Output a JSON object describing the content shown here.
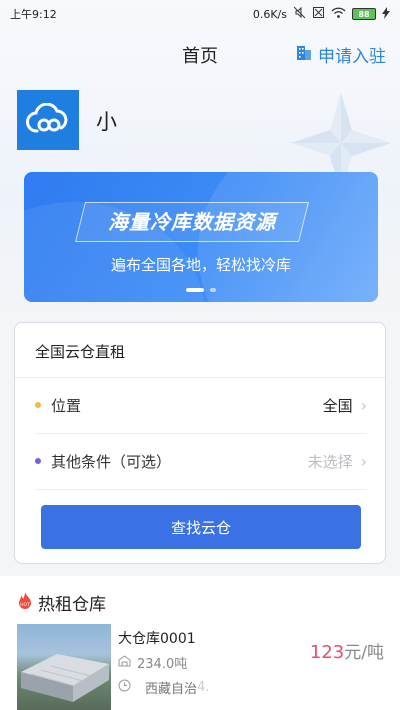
{
  "status_bar": {
    "time": "上午9:12",
    "network_speed": "0.6K/s",
    "battery": "88"
  },
  "nav": {
    "title": "首页",
    "apply_label": "申请入驻"
  },
  "brand": {
    "name": "小"
  },
  "banner": {
    "title": "海量冷库数据资源",
    "subtitle": "遍布全国各地，轻松找冷库",
    "slide_count": 2,
    "active_slide": 1
  },
  "search_card": {
    "title": "全国云仓直租",
    "location_label": "位置",
    "location_value": "全国",
    "conditions_label": "其他条件（可选）",
    "conditions_value": "未选择",
    "button_label": "查找云仓"
  },
  "hot": {
    "badge": "HOT",
    "title": "热租仓库",
    "items": [
      {
        "name": "大仓库0001",
        "capacity": "234.0吨",
        "address": "西藏自治",
        "address_tail": "4.",
        "price": "123",
        "price_unit": "元/吨"
      }
    ]
  },
  "colors": {
    "accent": "#3a72e6",
    "apply": "#2f86d6",
    "price": "#e8506a",
    "location_dot": "#f5b942",
    "conditions_dot": "#7b5be6"
  }
}
